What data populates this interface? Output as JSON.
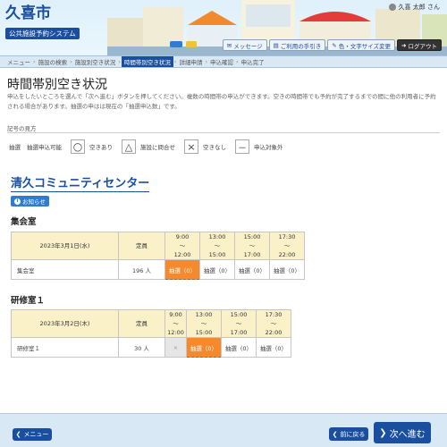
{
  "header": {
    "city_name": "久喜市",
    "system_name": "公共施設予約システム",
    "user_name": "久喜 太郎 さん",
    "buttons": [
      {
        "icon": "message-icon",
        "label": "メッセージ"
      },
      {
        "icon": "guide-icon",
        "label": "ご利用の手引き"
      },
      {
        "icon": "palette-icon",
        "label": "色・文字サイズ変更"
      },
      {
        "icon": "logout-icon",
        "label": "ログアウト"
      }
    ]
  },
  "breadcrumb": [
    "メニュー",
    "施設の検索",
    "施設別空き状況",
    "時間帯別空き状況",
    "詳細申請",
    "申込確認",
    "申込完了"
  ],
  "page_title": "時間帯別空き状況",
  "description": "申込をしたいところを選んで「次へ進む」ボタンを押してください。複数の時間帯の申込ができます。空きの時間帯でも予約が完了するまでの間に他の利用者に予約される場合があります。抽選の申はは現在の「抽選申込数」です。",
  "legend": {
    "heading": "記号の見方",
    "items": [
      {
        "symbol": "抽選",
        "text": "抽選申込可能"
      },
      {
        "symbol": "○",
        "text": "空きあり"
      },
      {
        "symbol": "△",
        "text": "施設に問合せ"
      },
      {
        "symbol": "×",
        "text": "空きなし"
      },
      {
        "symbol": "－",
        "text": "申込対象外"
      }
    ]
  },
  "facility": {
    "name": "清久コミュニティセンター",
    "notice_label": "お知らせ"
  },
  "capacity_header": "定員",
  "rooms": [
    {
      "title": "集会室",
      "date": "2023年3月1日(水)",
      "slots": [
        {
          "start": "9:00",
          "tilde": "～",
          "end": "12:00"
        },
        {
          "start": "13:00",
          "tilde": "～",
          "end": "15:00"
        },
        {
          "start": "15:00",
          "tilde": "～",
          "end": "17:00"
        },
        {
          "start": "17:30",
          "tilde": "～",
          "end": "22:00"
        }
      ],
      "row_name": "集会室",
      "capacity": "196 人",
      "cells": [
        {
          "text": "抽選（0）",
          "state": "selected"
        },
        {
          "text": "抽選（0）",
          "state": "lottery"
        },
        {
          "text": "抽選（0）",
          "state": "lottery"
        },
        {
          "text": "抽選（0）",
          "state": "lottery"
        }
      ]
    },
    {
      "title": "研修室１",
      "date": "2023年3月2日(木)",
      "slots": [
        {
          "start": "9:00",
          "tilde": "～",
          "end": "12:00"
        },
        {
          "start": "13:00",
          "tilde": "～",
          "end": "15:00"
        },
        {
          "start": "15:00",
          "tilde": "～",
          "end": "17:00"
        },
        {
          "start": "17:30",
          "tilde": "～",
          "end": "22:00"
        }
      ],
      "row_name": "研修室１",
      "capacity": "30 人",
      "cells": [
        {
          "text": "×",
          "state": "full"
        },
        {
          "text": "抽選（0）",
          "state": "selected"
        },
        {
          "text": "抽選（0）",
          "state": "lottery"
        },
        {
          "text": "抽選（0）",
          "state": "lottery"
        }
      ]
    }
  ],
  "footer": {
    "menu_label": "メニュー",
    "back_label": "前に戻る",
    "next_label": "次へ進む"
  },
  "colors": {
    "brand": "#1a4fa0",
    "selected": "#f5892b",
    "table_header": "#fbf1c8"
  }
}
